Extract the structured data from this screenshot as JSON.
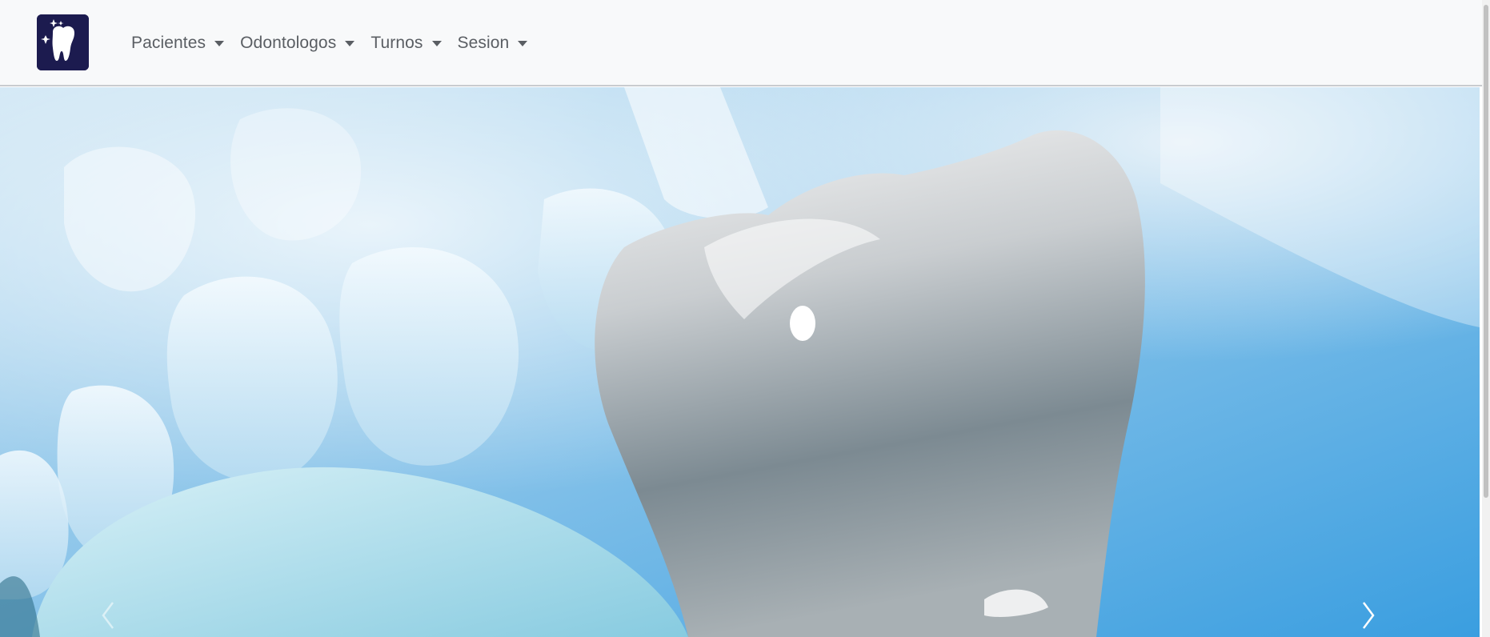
{
  "brand": {
    "logo": "tooth-logo-icon",
    "bg_color": "#1c1b4f"
  },
  "nav": {
    "items": [
      {
        "label": "Pacientes",
        "icon": "caret-down-icon"
      },
      {
        "label": "Odontologos",
        "icon": "caret-down-icon"
      },
      {
        "label": "Turnos",
        "icon": "caret-down-icon"
      },
      {
        "label": "Sesion",
        "icon": "caret-down-icon"
      }
    ]
  },
  "carousel": {
    "image": "teeth-hero-image",
    "prev_icon": "chevron-left-icon",
    "next_icon": "chevron-right-icon"
  },
  "colors": {
    "navbar_bg": "#f8f9fa",
    "nav_text": "#5a5e63"
  }
}
